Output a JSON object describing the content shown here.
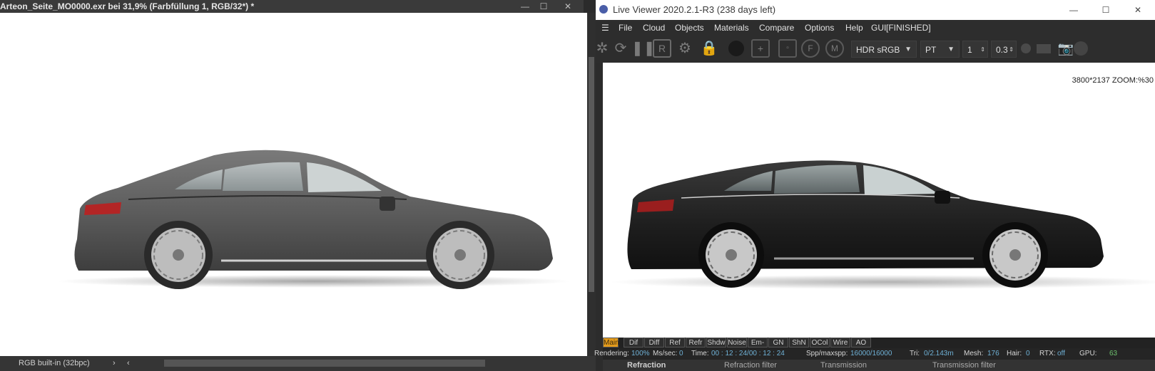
{
  "left_window": {
    "title": "Arteon_Seite_MO0000.exr bei 31,9% (Farbfüllung 1, RGB/32*) *",
    "status_profile": "RGB built-in (32bpc)",
    "nav_next": "›",
    "nav_prev": "‹",
    "minimize": "—",
    "maximize": "☐",
    "close": "✕"
  },
  "right_window": {
    "title": "Live Viewer 2020.2.1-R3 (238 days left)",
    "minimize": "—",
    "maximize": "☐",
    "close": "✕",
    "menu": [
      "File",
      "Cloud",
      "Objects",
      "Materials",
      "Compare",
      "Options",
      "Help",
      "GUI",
      "[FINISHED]"
    ],
    "hamburger": "☰",
    "toolbar": {
      "color_space": "HDR sRGB",
      "kernel": "PT",
      "value_a": "1",
      "value_b": "0.3"
    },
    "resolution_zoom": "3800*2137 ZOOM:%30",
    "passes": [
      "Main",
      "Dif",
      "Diff",
      "Ref",
      "Refr",
      "Shdw",
      "Noise",
      "Em-Mm",
      "GN",
      "ShN",
      "OCol",
      "Wire",
      "AO"
    ],
    "status": {
      "rendering_label": "Rendering:",
      "rendering_value": "100%",
      "mssec_label": "Ms/sec:",
      "mssec_value": "0",
      "time_label": "Time:",
      "time_value": "00 : 12 : 24/00 : 12 : 24",
      "spp_label": "Spp/maxspp:",
      "spp_value": "16000/16000",
      "tri_label": "Tri:",
      "tri_value": "0/2.143m",
      "mesh_label": "Mesh:",
      "mesh_value": "176",
      "hair_label": "Hair:",
      "hair_value": "0",
      "rtx_label": "RTX:",
      "rtx_value": "off",
      "gpu_label": "GPU:",
      "gpu_value": "63"
    },
    "bottom_panel": [
      "Refraction",
      "Refraction filter",
      "Transmission",
      "Transmission filter"
    ]
  },
  "colors": {
    "car_grey": "#5a5a5a",
    "car_black": "#1e1e1e",
    "active_pass": "#e39b1b"
  }
}
